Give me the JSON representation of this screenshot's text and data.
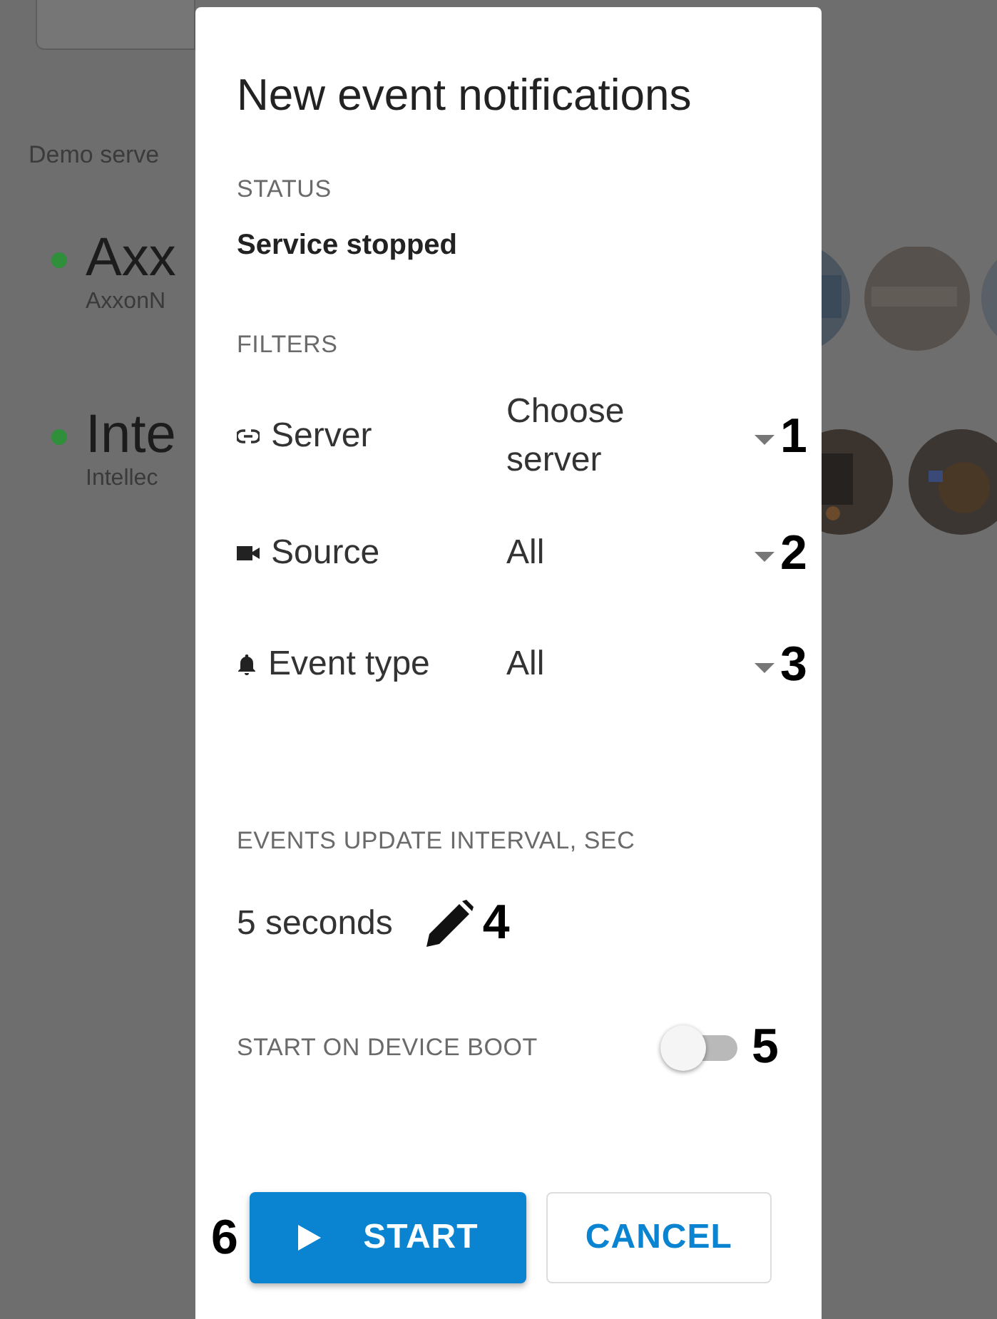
{
  "background": {
    "section_label": "Demo serve",
    "servers": [
      {
        "name": "Axx",
        "subtitle": "AxxonN",
        "color": "#2f8f3a"
      },
      {
        "name": "Inte",
        "subtitle": "Intellec",
        "color": "#2f8f3a"
      }
    ]
  },
  "dialog": {
    "title": "New event notifications",
    "status": {
      "label": "STATUS",
      "value": "Service stopped"
    },
    "filters": {
      "label": "FILTERS",
      "rows": [
        {
          "kind": "link",
          "label": "Server",
          "value": "Choose server",
          "callout": "1"
        },
        {
          "kind": "camera",
          "label": "Source",
          "value": "All",
          "callout": "2"
        },
        {
          "kind": "bell",
          "label": "Event type",
          "value": "All",
          "callout": "3"
        }
      ]
    },
    "interval": {
      "label": "EVENTS UPDATE INTERVAL, SEC",
      "value": "5 seconds",
      "callout": "4"
    },
    "boot": {
      "label": "START ON DEVICE BOOT",
      "on": false,
      "callout": "5"
    },
    "buttons": [
      {
        "kind": "primary",
        "label": "START",
        "callout": "6"
      },
      {
        "kind": "secondary",
        "label": "CANCEL"
      }
    ]
  }
}
